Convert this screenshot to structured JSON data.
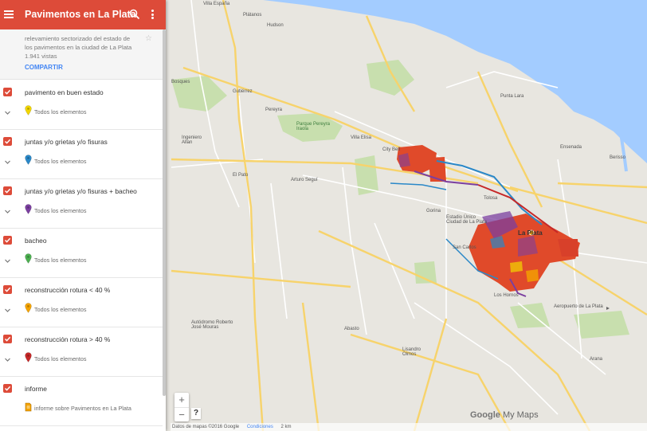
{
  "header": {
    "title": "Pavimentos en La Plata"
  },
  "description": {
    "text": "relevamiento sectorizado del estado de los pavimentos en la ciudad de La Plata",
    "views": "1.941 vistas",
    "share_label": "COMPARTIR"
  },
  "layers": [
    {
      "name": "pavimento en buen estado",
      "sub": "Todos los elementos",
      "pin_color": "#f2d600"
    },
    {
      "name": "juntas y/o grietas y/o fisuras",
      "sub": "Todos los elementos",
      "pin_color": "#2a88c8"
    },
    {
      "name": "juntas y/o grietas y/o fisuras + bacheo",
      "sub": "Todos los elementos",
      "pin_color": "#7b3fa0"
    },
    {
      "name": "bacheo",
      "sub": "Todos los elementos",
      "pin_color": "#4caf50"
    },
    {
      "name": "reconstrucción rotura < 40 %",
      "sub": "Todos los elementos",
      "pin_color": "#f4a300"
    },
    {
      "name": "reconstrucción rotura > 40 %",
      "sub": "Todos los elementos",
      "pin_color": "#c62828"
    },
    {
      "name": "informe",
      "sub": "informe sobre Pavimentos en La Plata"
    }
  ],
  "map": {
    "labels": {
      "villa_elisa": "Villa Elisa",
      "arturo_segui": "Arturo Seguí",
      "el_pato": "El Pato",
      "la_plata": "La Plata",
      "ensenada": "Ensenada",
      "berisso": "Berisso",
      "tolosa": "Tolosa",
      "city_bell": "City Bell",
      "gorina": "Gorina",
      "gutierrez": "Gutiérrez",
      "pereyra": "Pereyra",
      "platanos": "Plátanos",
      "villa_espana": "Villa España",
      "bosques": "Bosques",
      "ingeniero_allan": "Ingeniero Allan",
      "parque_pereyra": "Parque Pereyra Iraola",
      "estadio": "Estadio Único Ciudad de La Plata",
      "san_carlos": "San Carlos",
      "los_hornos": "Los Hornos",
      "abasto": "Abasto",
      "lisandro_olmos": "Lisandro Olmos",
      "arana": "Arana",
      "autodromo": "Autódromo Roberto José Mouras",
      "aeropuerto": "Aeropuerto de La Plata",
      "punta_lara": "Punta Lara",
      "hudson": "Hudson"
    },
    "google_label": "Google",
    "mymaps_label": "My Maps",
    "footer_copyright": "Datos de mapas ©2016 Google",
    "footer_conditions": "Condiciones",
    "footer_scale": "2 km"
  },
  "colors": {
    "header": "#dd4b39",
    "water": "#a3ccff",
    "land": "#e8e6e0",
    "park": "#c8dfae",
    "road_major": "#f7d36b",
    "road_minor": "#ffffff"
  }
}
